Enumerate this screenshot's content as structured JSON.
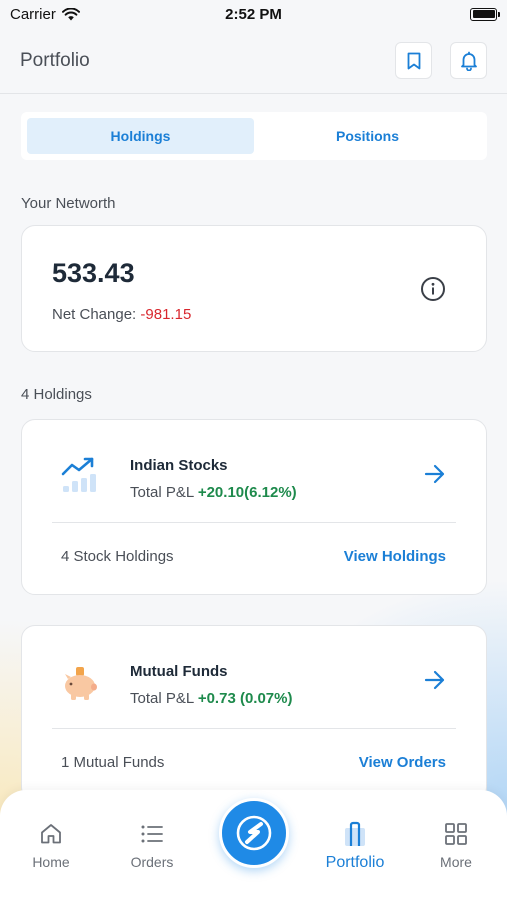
{
  "status_bar": {
    "carrier": "Carrier",
    "time": "2:52 PM"
  },
  "header": {
    "title": "Portfolio",
    "bookmark_icon": "bookmark-icon",
    "bell_icon": "bell-icon"
  },
  "tabs": [
    {
      "label": "Holdings",
      "active": true
    },
    {
      "label": "Positions",
      "active": false
    }
  ],
  "networth": {
    "section_label": "Your Networth",
    "value": "533.43",
    "change_label": "Net Change:",
    "change_value": "-981.15"
  },
  "holdings": {
    "section_label": "4 Holdings",
    "items": [
      {
        "name": "Indian Stocks",
        "pl_label": "Total P&L",
        "pl_value": "+20.10(6.12%)",
        "count_text": "4 Stock Holdings",
        "link_text": "View Holdings",
        "icon": "trending-chart-icon"
      },
      {
        "name": "Mutual Funds",
        "pl_label": "Total P&L",
        "pl_value": "+0.73 (0.07%)",
        "count_text": "1 Mutual Funds",
        "link_text": "View Orders",
        "icon": "piggy-bank-icon"
      }
    ]
  },
  "bottom_nav": {
    "items": [
      {
        "label": "Home",
        "icon": "home-icon"
      },
      {
        "label": "Orders",
        "icon": "list-icon"
      },
      {
        "label": "Portfolio",
        "icon": "portfolio-icon",
        "active": true
      },
      {
        "label": "More",
        "icon": "grid-icon"
      }
    ],
    "center_icon": "app-logo-icon"
  },
  "colors": {
    "accent": "#1b7fd6",
    "positive": "#1e8a4c",
    "negative": "#d8272e",
    "tab_active_bg": "#e1effb"
  }
}
